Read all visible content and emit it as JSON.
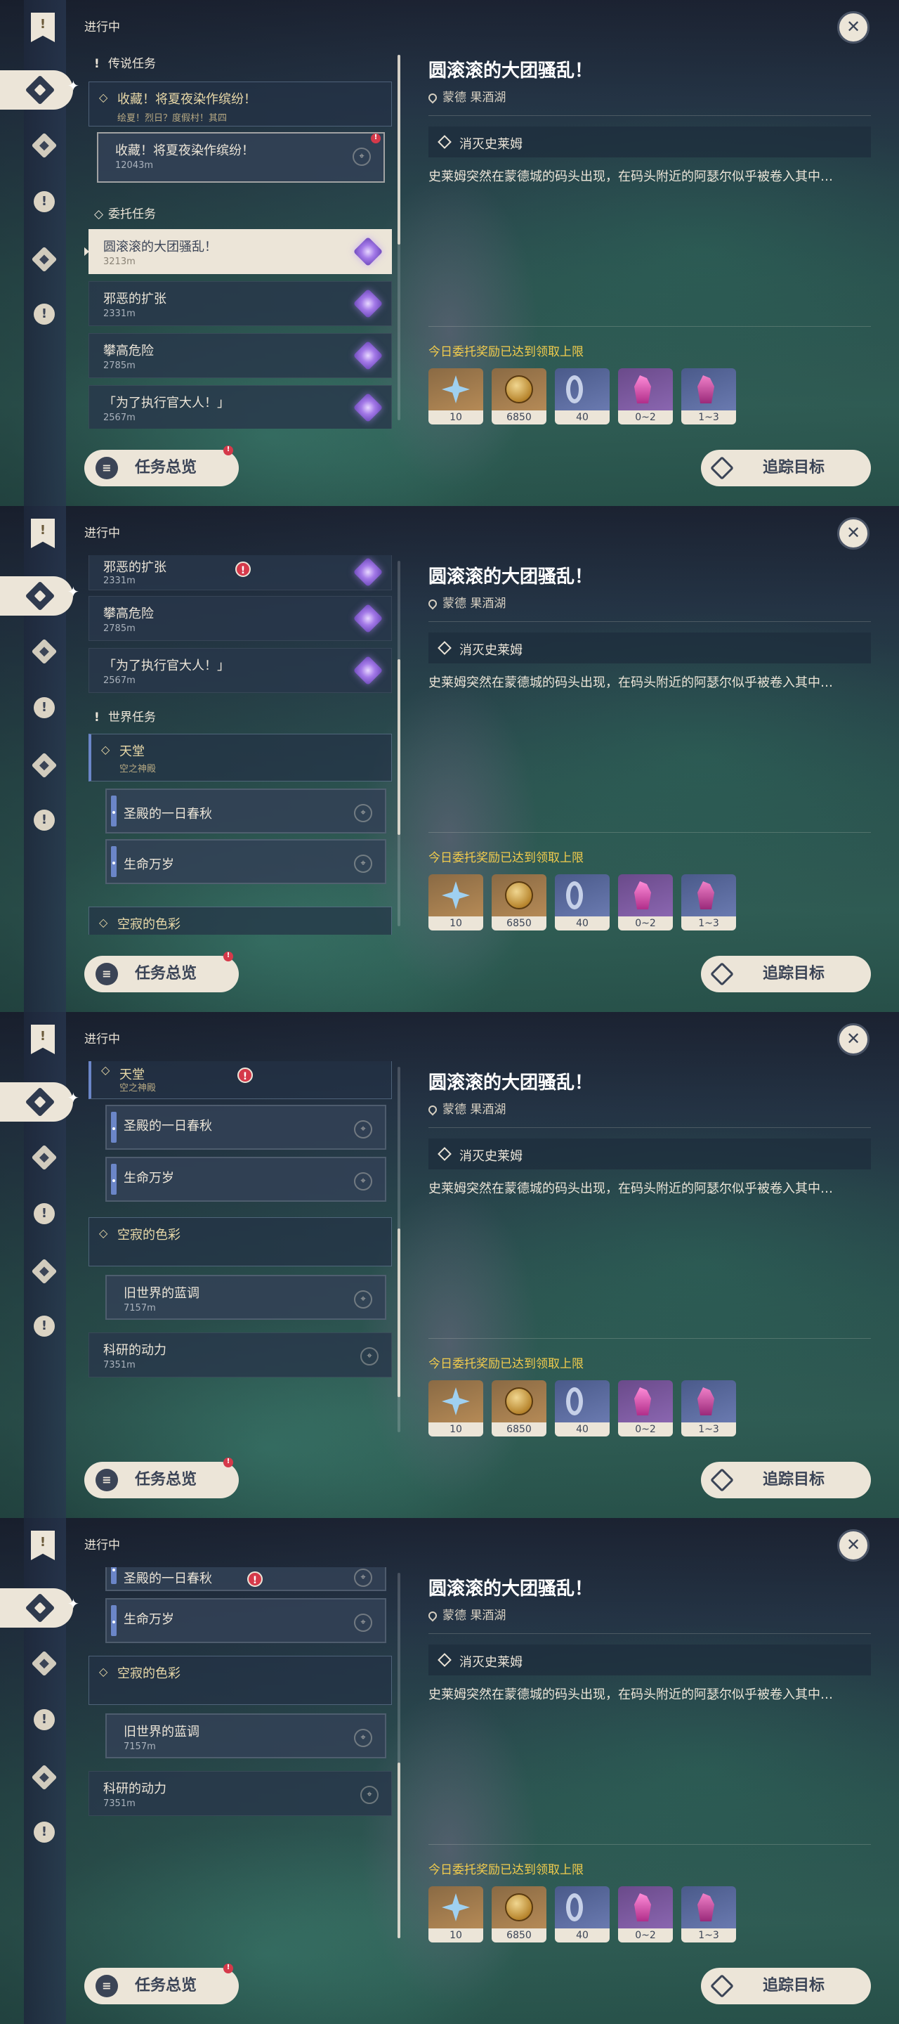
{
  "status_label": "进行中",
  "overview_button": "任务总览",
  "track_button": "追踪目标",
  "detail": {
    "title": "圆滚滚的大团骚乱！",
    "location": "蒙德 果酒湖",
    "objective": "消灭史莱姆",
    "description": "史莱姆突然在蒙德城的码头出现，在码头附近的阿瑟尔似乎被卷入其中…",
    "reward_note": "今日委托奖励已达到领取上限",
    "rewards": [
      {
        "icon": "primogem-icon",
        "qty": "10"
      },
      {
        "icon": "mora-icon",
        "qty": "6850"
      },
      {
        "icon": "adventure-exp-icon",
        "qty": "40"
      },
      {
        "icon": "crystal-fragment-icon",
        "qty": "0~2"
      },
      {
        "icon": "crystal-icon",
        "qty": "1~3"
      }
    ]
  },
  "categories": {
    "legend": "传说任务",
    "commission": "委托任务",
    "world": "世界任务"
  },
  "quests": {
    "legend_head": {
      "title": "收藏！将夏夜染作缤纷！",
      "subtitle": "绘夏！烈日？度假村！其四"
    },
    "legend_sub": {
      "title": "收藏！将夏夜染作缤纷！",
      "distance": "12043m"
    },
    "commissions": [
      {
        "title": "圆滚滚的大团骚乱！",
        "distance": "3213m"
      },
      {
        "title": "邪恶的扩张",
        "distance": "2331m"
      },
      {
        "title": "攀高危险",
        "distance": "2785m"
      },
      {
        "title": "「为了执行官大人！」",
        "distance": "2567m"
      }
    ],
    "world_head": {
      "title": "天堂",
      "subtitle": "空之神殿"
    },
    "world_subs": [
      {
        "title": "圣殿的一日春秋"
      },
      {
        "title": "生命万岁"
      }
    ],
    "world_head2": {
      "title": "空寂的色彩"
    },
    "world_sub2": {
      "title": "旧世界的蓝调",
      "distance": "7157m"
    },
    "world_other": {
      "title": "科研的动力",
      "distance": "7351m"
    }
  },
  "icons": {
    "close": "close-icon",
    "bookmark": "quest-bookmark-icon"
  },
  "colors": {
    "accent": "#ece5d8",
    "reward_note": "#f2cc4d",
    "alert": "#d5394a"
  }
}
